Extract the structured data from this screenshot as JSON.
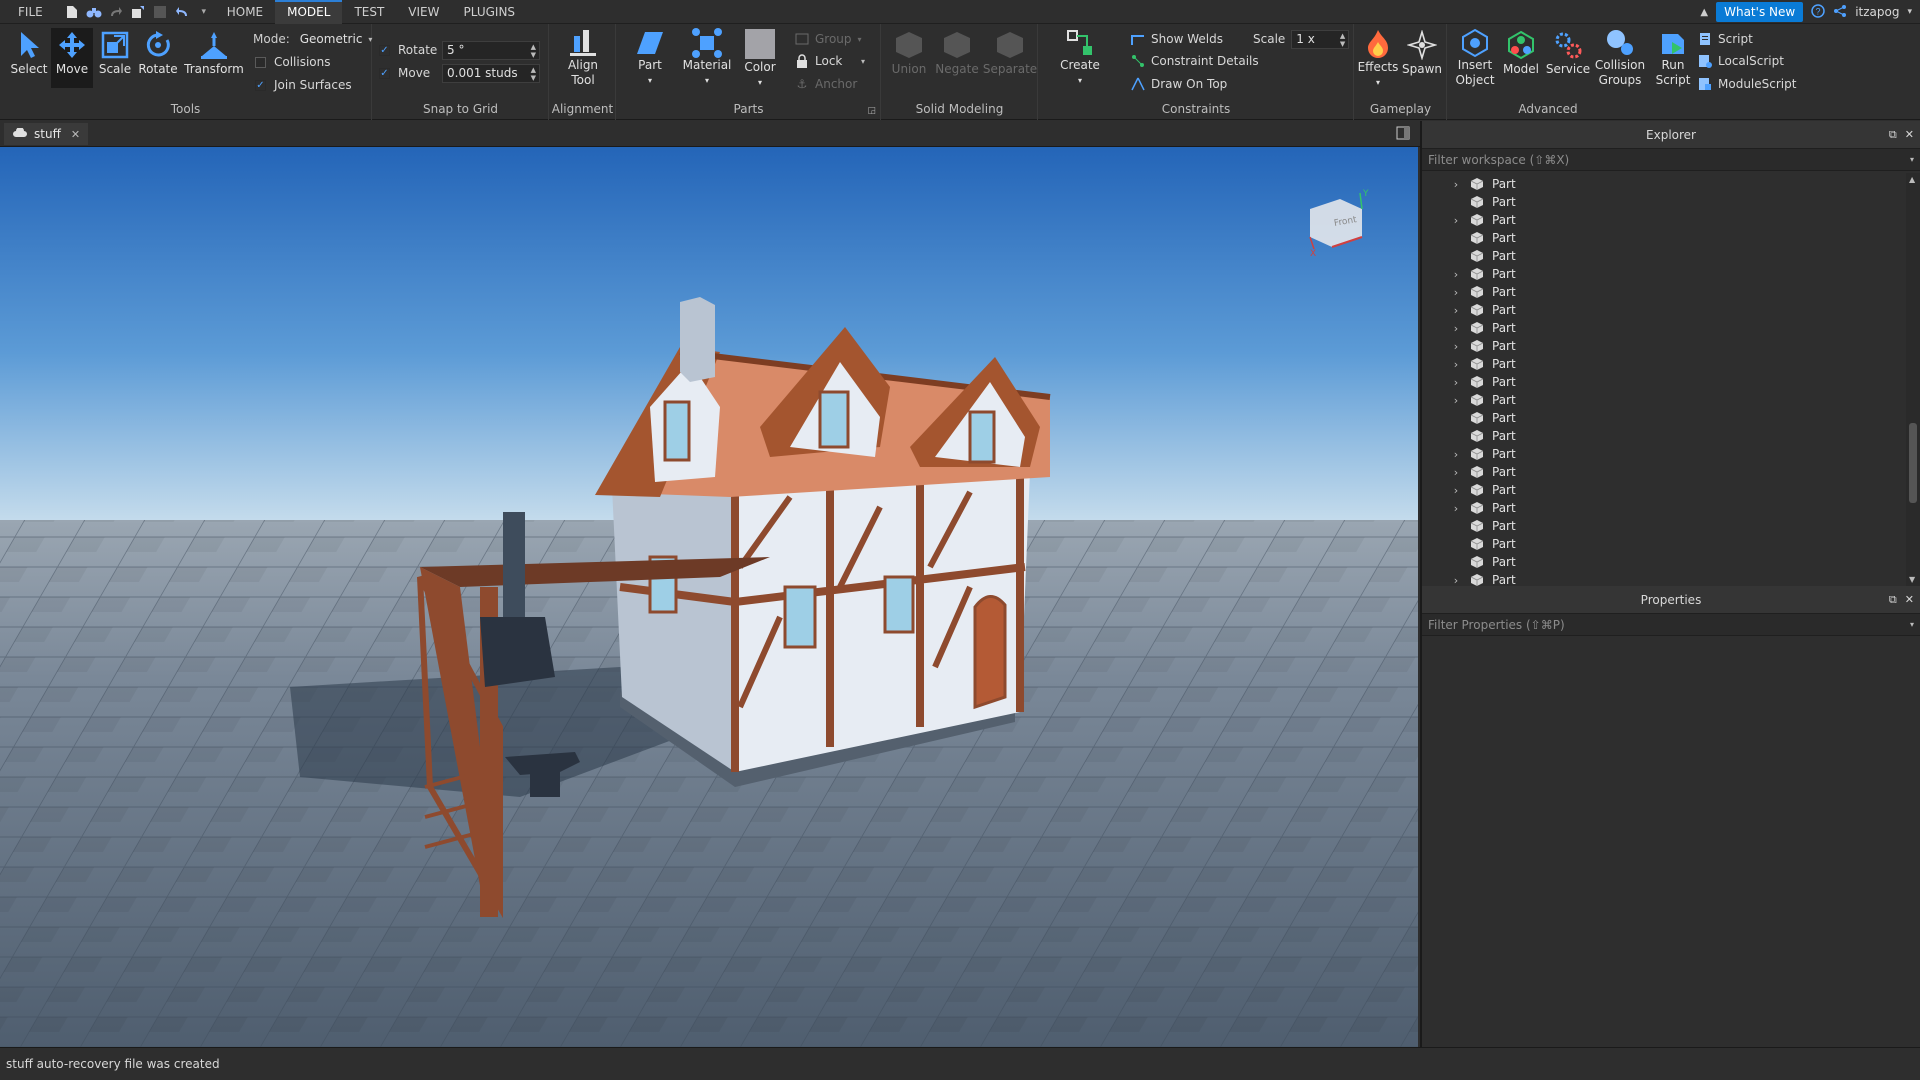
{
  "menubar": {
    "file": "FILE",
    "tabs": [
      {
        "label": "HOME"
      },
      {
        "label": "MODEL"
      },
      {
        "label": "TEST"
      },
      {
        "label": "VIEW"
      },
      {
        "label": "PLUGINS"
      }
    ],
    "active_tab": "MODEL",
    "whats_new": "What's New",
    "username": "itzapog"
  },
  "ribbon": {
    "tools": {
      "label": "Tools",
      "select": "Select",
      "move": "Move",
      "scale": "Scale",
      "rotate": "Rotate",
      "transform": "Transform",
      "mode_label": "Mode:",
      "mode_value": "Geometric",
      "collisions": "Collisions",
      "collisions_checked": false,
      "join_surfaces": "Join Surfaces",
      "join_surfaces_checked": true
    },
    "snap": {
      "label": "Snap to Grid",
      "rotate": "Rotate",
      "rotate_value": "5 °",
      "move": "Move",
      "move_value": "0.001 studs"
    },
    "alignment": {
      "label": "Alignment",
      "align_tool_line1": "Align",
      "align_tool_line2": "Tool"
    },
    "parts": {
      "label": "Parts",
      "part": "Part",
      "material": "Material",
      "color": "Color",
      "group": "Group",
      "lock": "Lock",
      "anchor": "Anchor"
    },
    "solid_modeling": {
      "label": "Solid Modeling",
      "union": "Union",
      "negate": "Negate",
      "separate": "Separate"
    },
    "constraints": {
      "label": "Constraints",
      "create": "Create",
      "show_welds": "Show Welds",
      "constraint_details": "Constraint Details",
      "draw_on_top": "Draw On Top",
      "scale_label": "Scale",
      "scale_value": "1 x"
    },
    "gameplay": {
      "label": "Gameplay",
      "effects": "Effects",
      "spawn": "Spawn"
    },
    "advanced": {
      "label": "Advanced",
      "insert_object_line1": "Insert",
      "insert_object_line2": "Object",
      "model": "Model",
      "service": "Service",
      "collision_groups_line1": "Collision",
      "collision_groups_line2": "Groups",
      "run_script_line1": "Run",
      "run_script_line2": "Script",
      "script": "Script",
      "local_script": "LocalScript",
      "module_script": "ModuleScript"
    }
  },
  "document_tab": {
    "label": "stuff"
  },
  "viewcube": {
    "front_label": "Front",
    "x_label": "X",
    "y_label": "Y"
  },
  "explorer": {
    "title": "Explorer",
    "filter_placeholder": "Filter workspace (⇧⌘X)",
    "items": [
      {
        "label": "Part",
        "expandable": true
      },
      {
        "label": "Part",
        "expandable": false
      },
      {
        "label": "Part",
        "expandable": true
      },
      {
        "label": "Part",
        "expandable": false
      },
      {
        "label": "Part",
        "expandable": false
      },
      {
        "label": "Part",
        "expandable": true
      },
      {
        "label": "Part",
        "expandable": true
      },
      {
        "label": "Part",
        "expandable": true
      },
      {
        "label": "Part",
        "expandable": true
      },
      {
        "label": "Part",
        "expandable": true
      },
      {
        "label": "Part",
        "expandable": true
      },
      {
        "label": "Part",
        "expandable": true
      },
      {
        "label": "Part",
        "expandable": true
      },
      {
        "label": "Part",
        "expandable": false
      },
      {
        "label": "Part",
        "expandable": false
      },
      {
        "label": "Part",
        "expandable": true
      },
      {
        "label": "Part",
        "expandable": true
      },
      {
        "label": "Part",
        "expandable": true
      },
      {
        "label": "Part",
        "expandable": true
      },
      {
        "label": "Part",
        "expandable": false
      },
      {
        "label": "Part",
        "expandable": false
      },
      {
        "label": "Part",
        "expandable": false
      },
      {
        "label": "Part",
        "expandable": true
      }
    ]
  },
  "properties": {
    "title": "Properties",
    "filter_placeholder": "Filter Properties (⇧⌘P)"
  },
  "status": {
    "message": "stuff auto-recovery file was created"
  },
  "colors": {
    "accent": "#0a7bd6",
    "panel_bg": "#2e2e2e",
    "sky_top": "#2a6fc0",
    "sky_horizon": "#b8d2e6",
    "ground": "#5a6878"
  }
}
